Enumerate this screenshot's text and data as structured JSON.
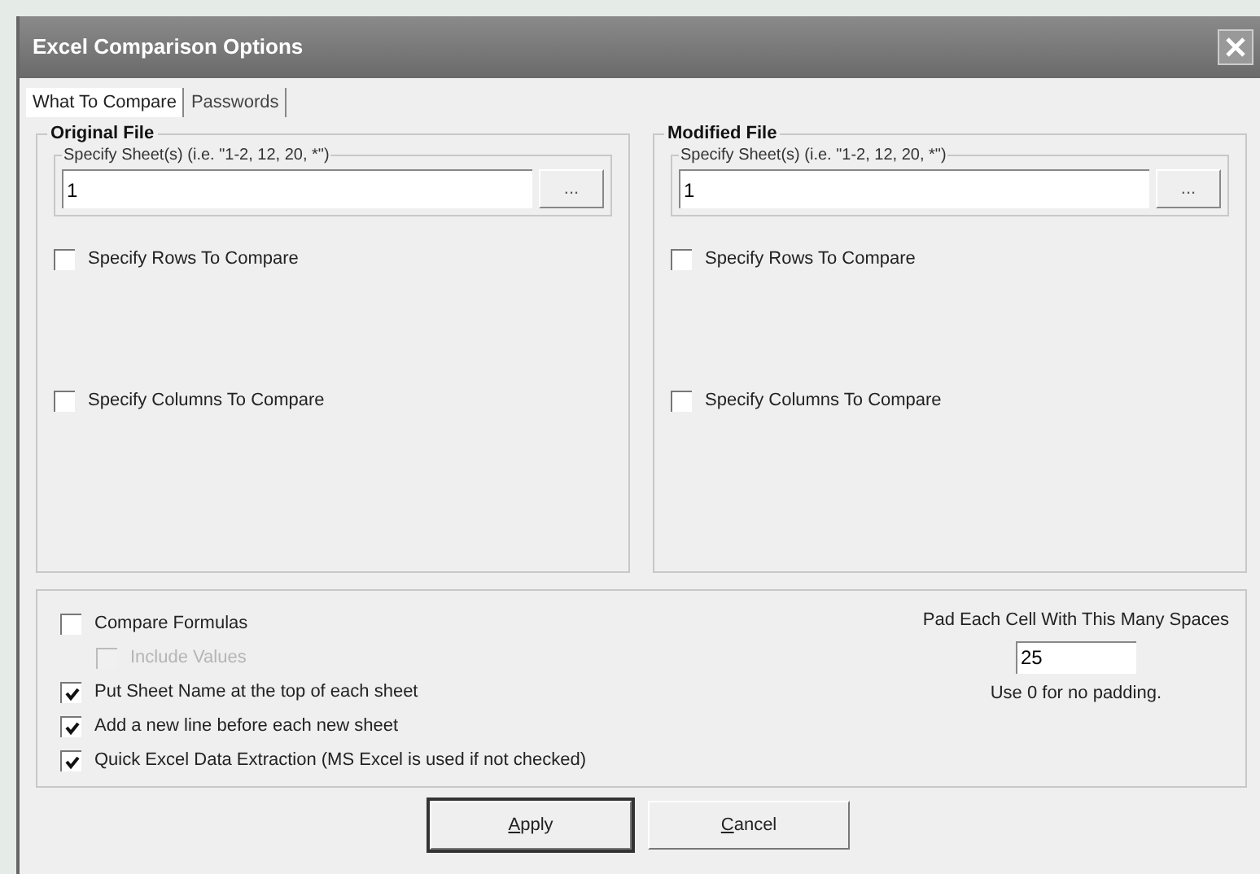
{
  "window": {
    "title": "Excel Comparison Options"
  },
  "tabs": [
    {
      "label": "What To Compare",
      "selected": true
    },
    {
      "label": "Passwords",
      "selected": false
    }
  ],
  "files": [
    {
      "title": "Original File",
      "sheets_label": "Specify Sheet(s) (i.e. \"1-2, 12, 20, *\")",
      "sheets_value": "1",
      "browse": "...",
      "options": [
        {
          "label": "Specify Rows To Compare",
          "checked": false,
          "disabled": false
        },
        {
          "label": "Specify Columns To Compare",
          "checked": false,
          "disabled": false
        }
      ]
    },
    {
      "title": "Modified File",
      "sheets_label": "Specify Sheet(s) (i.e. \"1-2, 12, 20, *\")",
      "sheets_value": "1",
      "browse": "...",
      "options": [
        {
          "label": "Specify Rows To Compare",
          "checked": false,
          "disabled": false
        },
        {
          "label": "Specify Columns To Compare",
          "checked": false,
          "disabled": false
        }
      ]
    }
  ],
  "options": [
    {
      "label": "Compare Formulas",
      "checked": false,
      "disabled": false,
      "children": [
        {
          "label": "Include Values",
          "checked": false,
          "disabled": true
        }
      ]
    },
    {
      "label": "Put Sheet Name at the top of each sheet",
      "checked": true,
      "disabled": false
    },
    {
      "label": "Add a new line before each new sheet",
      "checked": true,
      "disabled": false
    },
    {
      "label": "Quick Excel Data Extraction (MS Excel is used if not checked)",
      "checked": true,
      "disabled": false
    }
  ],
  "padding": {
    "label": "Pad Each Cell With This Many Spaces",
    "value": "25",
    "hint": "Use 0 for no padding."
  },
  "buttons": [
    {
      "accel": "A",
      "rest": "pply",
      "default": true
    },
    {
      "accel": "C",
      "rest": "ancel",
      "default": false
    }
  ]
}
